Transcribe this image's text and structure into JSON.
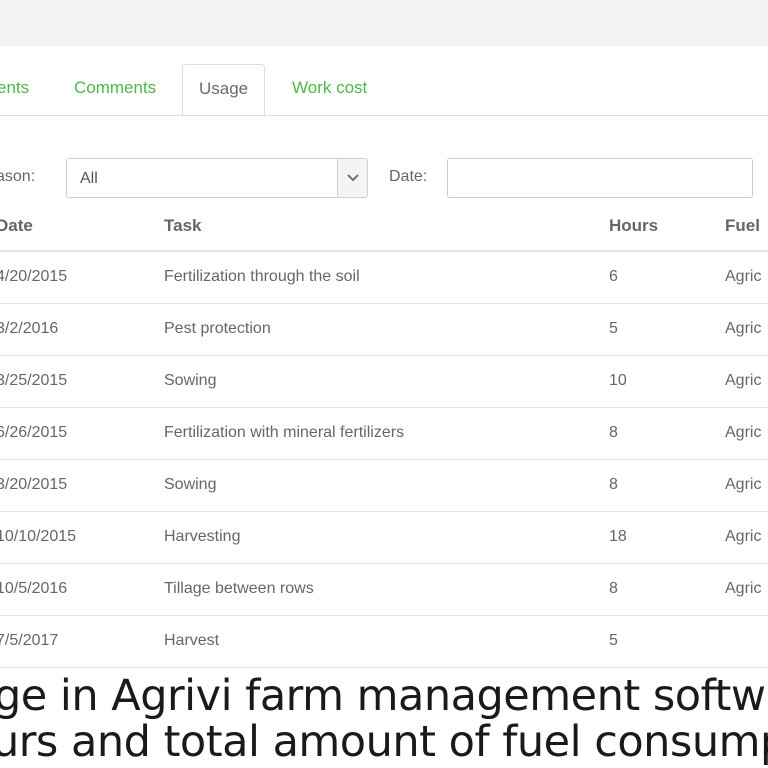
{
  "tabs": [
    {
      "label": "ents",
      "active": false
    },
    {
      "label": "Comments",
      "active": false
    },
    {
      "label": "Usage",
      "active": true
    },
    {
      "label": "Work cost",
      "active": false
    }
  ],
  "filters": {
    "season_label": "ason:",
    "season_value": "All",
    "date_label": "Date:",
    "date_value": ""
  },
  "table": {
    "headers": {
      "date": "Date",
      "task": "Task",
      "hours": "Hours",
      "fuel": "Fuel"
    },
    "rows": [
      {
        "date": "4/20/2015",
        "task": "Fertilization through the soil",
        "hours": "6",
        "fuel": "Agric"
      },
      {
        "date": "3/2/2016",
        "task": "Pest protection",
        "hours": "5",
        "fuel": "Agric"
      },
      {
        "date": "3/25/2015",
        "task": "Sowing",
        "hours": "10",
        "fuel": "Agric"
      },
      {
        "date": "6/26/2015",
        "task": "Fertilization with mineral fertilizers",
        "hours": "8",
        "fuel": "Agric"
      },
      {
        "date": "3/20/2015",
        "task": "Sowing",
        "hours": "8",
        "fuel": "Agric"
      },
      {
        "date": "10/10/2015",
        "task": "Harvesting",
        "hours": "18",
        "fuel": "Agric"
      },
      {
        "date": "10/5/2016",
        "task": "Tillage between rows",
        "hours": "8",
        "fuel": "Agric"
      },
      {
        "date": "7/5/2017",
        "task": "Harvest",
        "hours": "5",
        "fuel": ""
      }
    ]
  },
  "caption": {
    "line1": "ge in Agrivi farm management softwa",
    "line2": "urs and total amount of fuel consumpti"
  },
  "colors": {
    "accent_green": "#4cb848",
    "border": "#dcdcdc"
  },
  "icons": {
    "select_arrow": "chevron-down-icon"
  }
}
